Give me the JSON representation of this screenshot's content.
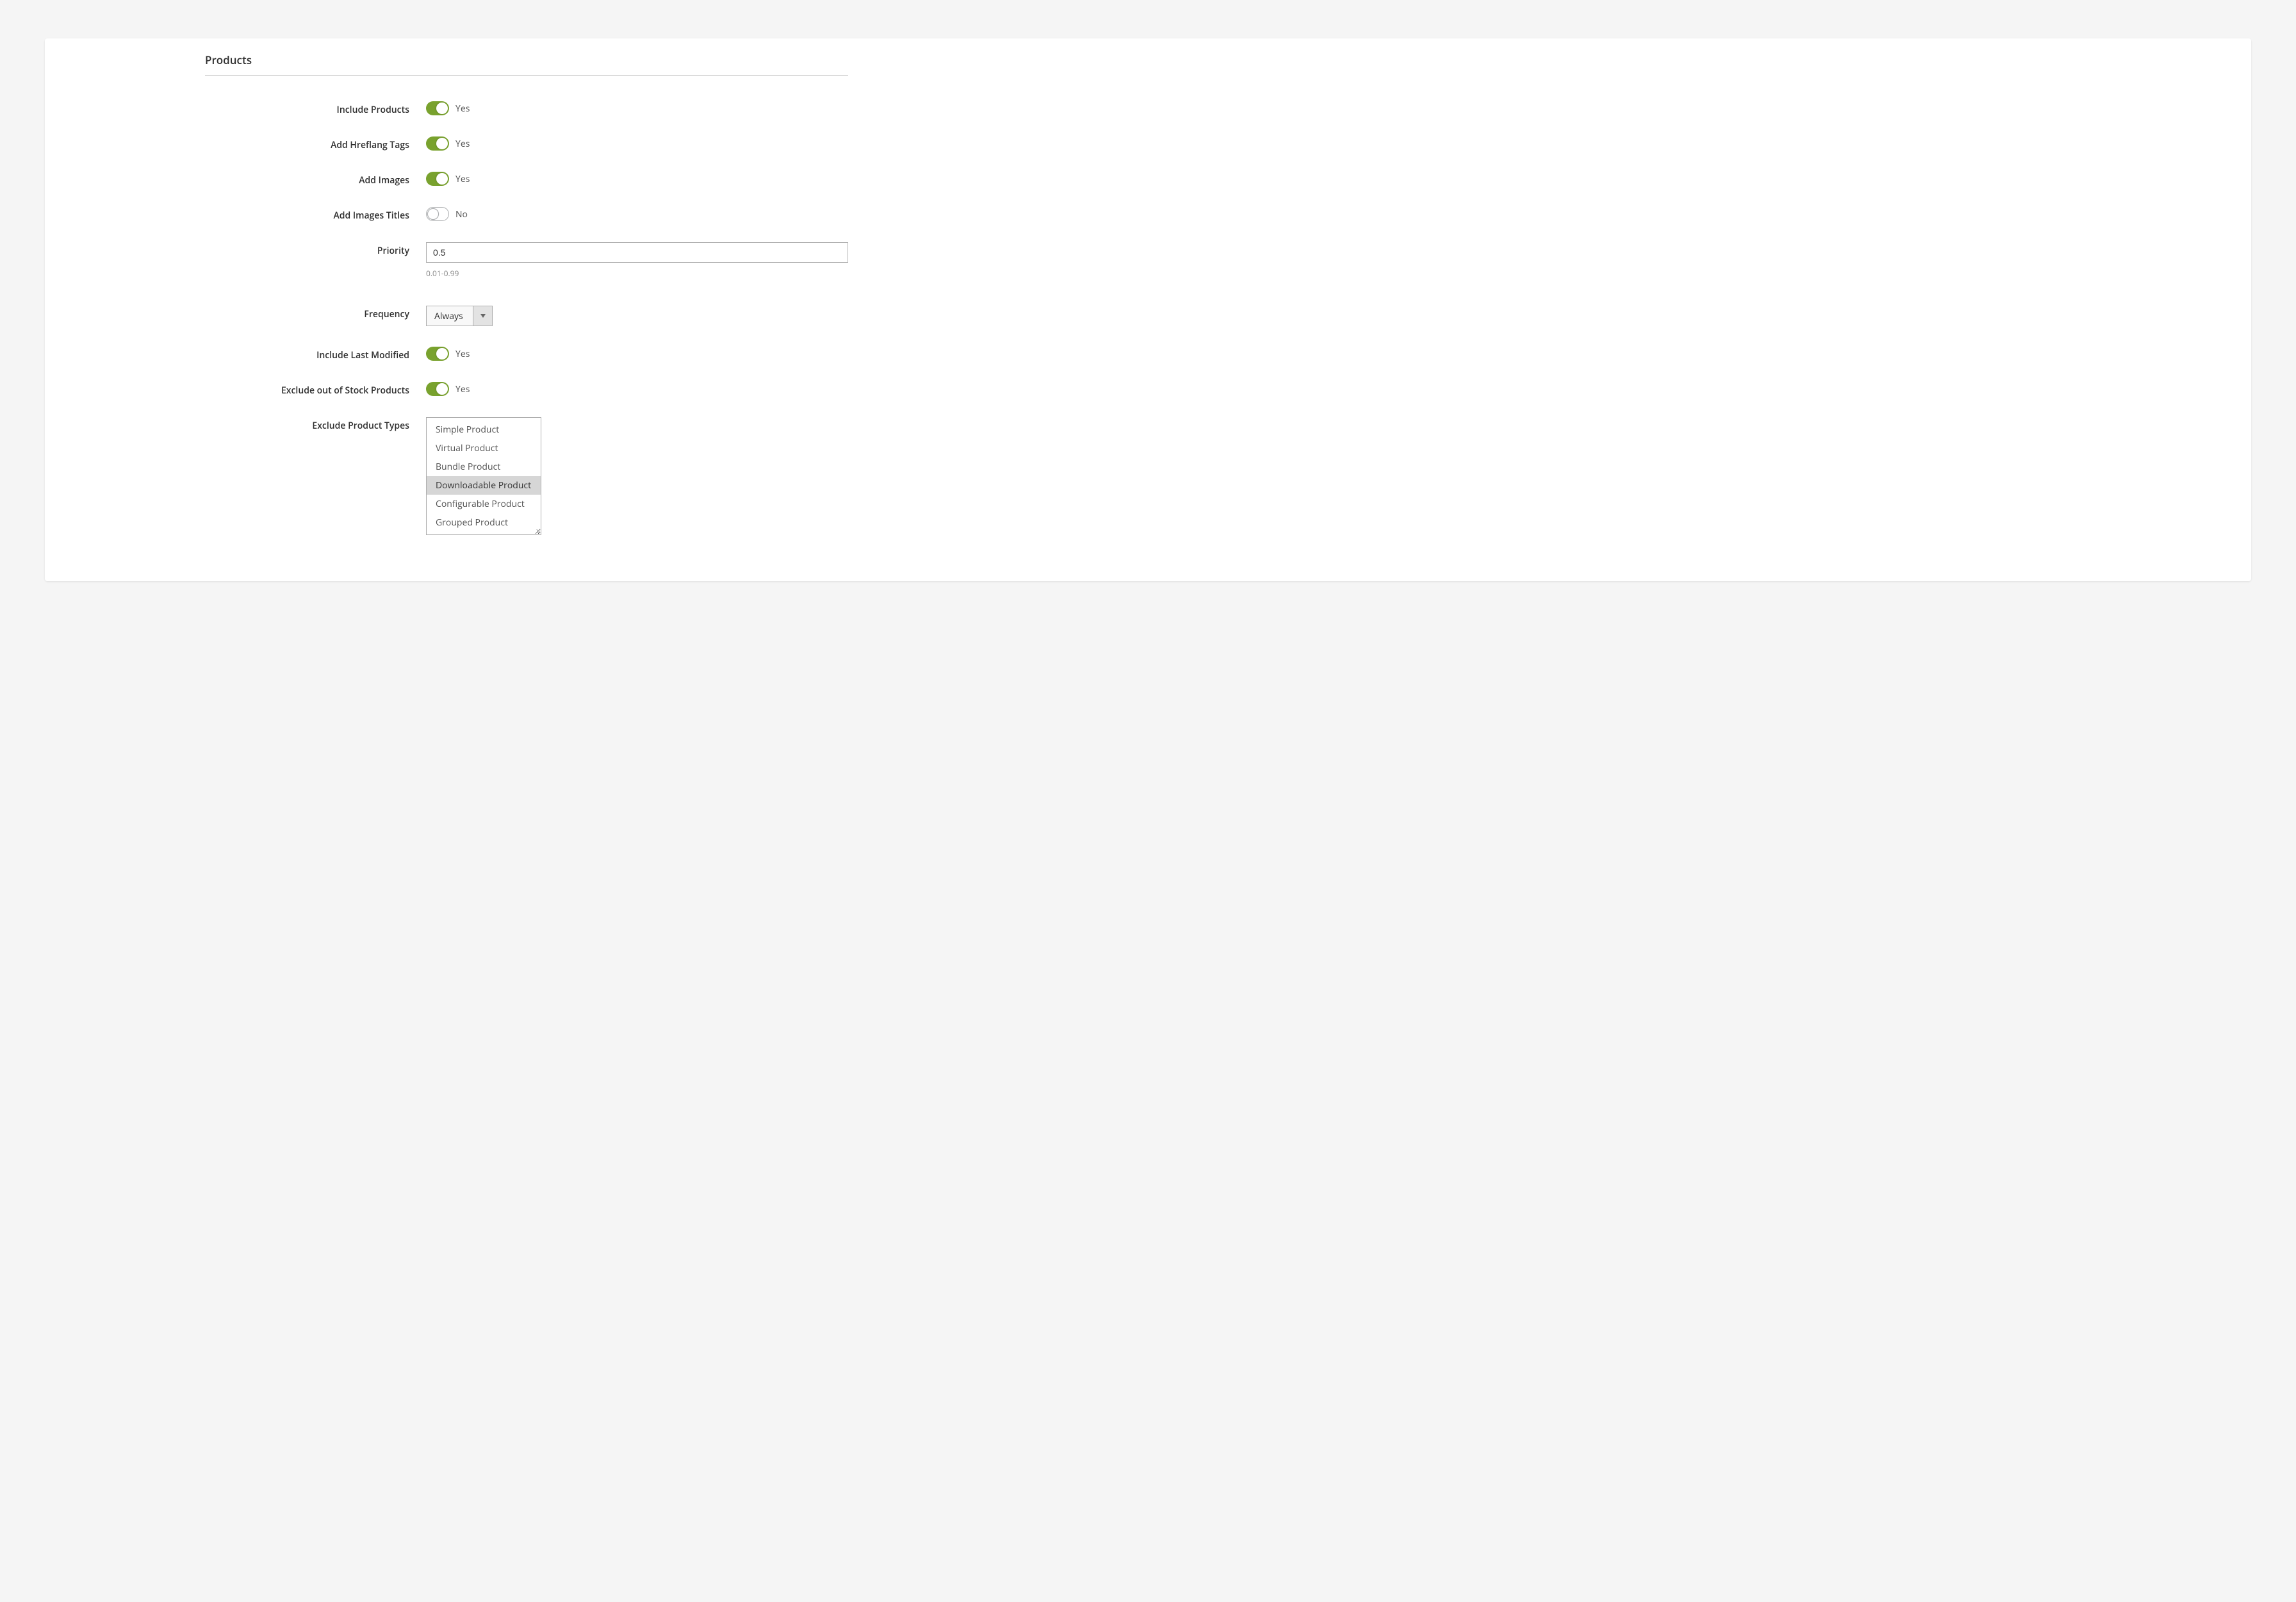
{
  "section": {
    "title": "Products"
  },
  "fields": {
    "include_products": {
      "label": "Include Products",
      "value": "Yes",
      "on": true
    },
    "add_hreflang": {
      "label": "Add Hreflang Tags",
      "value": "Yes",
      "on": true
    },
    "add_images": {
      "label": "Add Images",
      "value": "Yes",
      "on": true
    },
    "add_images_titles": {
      "label": "Add Images Titles",
      "value": "No",
      "on": false
    },
    "priority": {
      "label": "Priority",
      "value": "0.5",
      "help": "0.01-0.99"
    },
    "frequency": {
      "label": "Frequency",
      "value": "Always"
    },
    "include_last_modified": {
      "label": "Include Last Modified",
      "value": "Yes",
      "on": true
    },
    "exclude_out_of_stock": {
      "label": "Exclude out of Stock Products",
      "value": "Yes",
      "on": true
    },
    "exclude_product_types": {
      "label": "Exclude Product Types",
      "options": [
        "Simple Product",
        "Virtual Product",
        "Bundle Product",
        "Downloadable Product",
        "Configurable Product",
        "Grouped Product"
      ],
      "selected_index": 3
    }
  }
}
